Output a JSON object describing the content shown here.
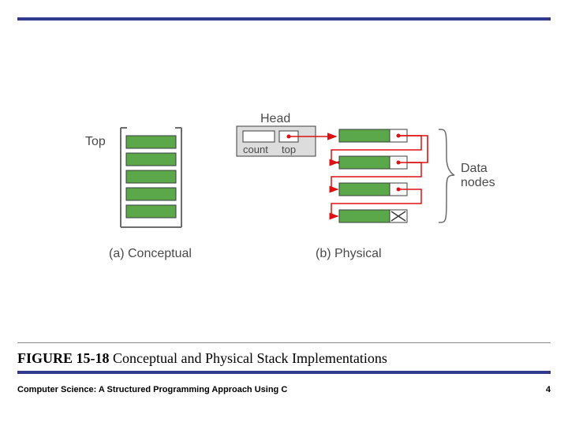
{
  "figure": {
    "number": "FIGURE 15-18",
    "title": "Conceptual and Physical Stack Implementations",
    "labels": {
      "top": "Top",
      "head": "Head",
      "count": "count",
      "top_ptr": "top",
      "data_nodes": "Data\nnodes"
    },
    "subcaptions": {
      "a": "(a) Conceptual",
      "b": "(b) Physical"
    }
  },
  "footer": {
    "text": "Computer Science: A Structured Programming Approach Using C",
    "page": "4"
  },
  "chart_data": {
    "type": "other",
    "title": "Conceptual and Physical Stack Implementations",
    "parts": [
      {
        "label": "(a) Conceptual",
        "structure": "array-stack",
        "top_indicator": "Top",
        "cells_shown": 5
      },
      {
        "label": "(b) Physical",
        "structure": "linked-list-stack",
        "head": {
          "fields": [
            "count",
            "top"
          ]
        },
        "data_nodes_shown": 4,
        "terminator": "null (X box)",
        "annotation": "Data nodes"
      }
    ]
  }
}
